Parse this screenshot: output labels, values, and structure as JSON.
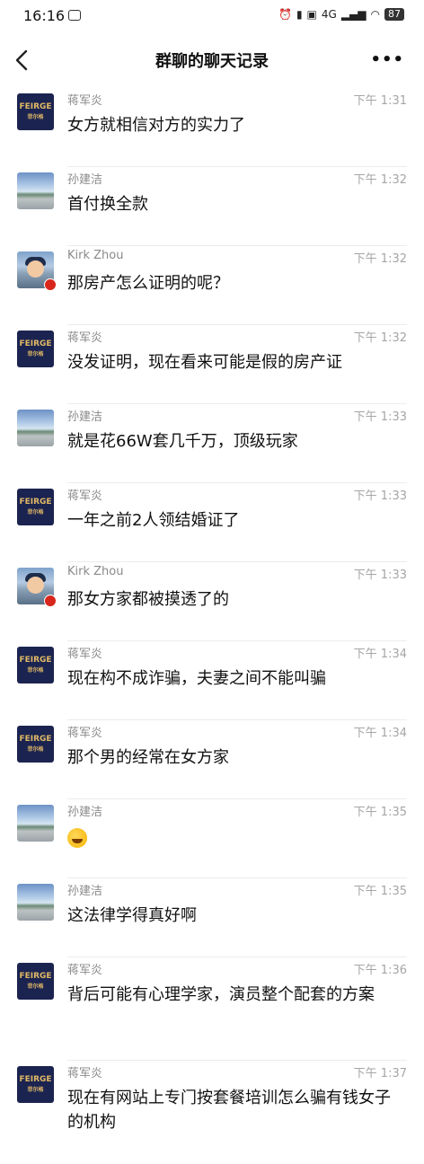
{
  "status_bar": {
    "time": "16:16",
    "network": "4G",
    "battery": "87"
  },
  "nav": {
    "title": "群聊的聊天记录",
    "more_label": "•••"
  },
  "messages": [
    {
      "sender": "蒋军炎",
      "time": "下午 1:31",
      "text": "女方就相信对方的实力了",
      "avatar": "feirage-logo"
    },
    {
      "sender": "孙建洁",
      "time": "下午 1:32",
      "text": "首付换全款",
      "avatar": "sky-landscape"
    },
    {
      "sender": "Kirk Zhou",
      "time": "下午 1:32",
      "text": "那房产怎么证明的呢？",
      "avatar": "anime-boy"
    },
    {
      "sender": "蒋军炎",
      "time": "下午 1:32",
      "text": "没发证明，现在看来可能是假的房产证",
      "avatar": "feirage-logo"
    },
    {
      "sender": "孙建洁",
      "time": "下午 1:33",
      "text": "就是花66W套几千万，顶级玩家",
      "avatar": "sky-landscape"
    },
    {
      "sender": "蒋军炎",
      "time": "下午 1:33",
      "text": "一年之前2人领结婚证了",
      "avatar": "feirage-logo"
    },
    {
      "sender": "Kirk Zhou",
      "time": "下午 1:33",
      "text": "那女方家都被摸透了的",
      "avatar": "anime-boy"
    },
    {
      "sender": "蒋军炎",
      "time": "下午 1:34",
      "text": "现在构不成诈骗，夫妻之间不能叫骗",
      "avatar": "feirage-logo"
    },
    {
      "sender": "蒋军炎",
      "time": "下午 1:34",
      "text": "那个男的经常在女方家",
      "avatar": "feirage-logo"
    },
    {
      "sender": "孙建洁",
      "time": "下午 1:35",
      "text": "",
      "emoji": "laughing-crying-emoji",
      "avatar": "sky-landscape"
    },
    {
      "sender": "孙建洁",
      "time": "下午 1:35",
      "text": "这法律学得真好啊",
      "avatar": "sky-landscape"
    },
    {
      "sender": "蒋军炎",
      "time": "下午 1:36",
      "text": "背后可能有心理学家，演员整个配套的方案",
      "avatar": "feirage-logo"
    },
    {
      "sender": "蒋军炎",
      "time": "下午 1:37",
      "text": "现在有网站上专门按套餐培训怎么骗有钱女子的机构",
      "avatar": "feirage-logo"
    }
  ],
  "logo_text": {
    "main": "FEIRGE",
    "sub": "菲尔格"
  }
}
